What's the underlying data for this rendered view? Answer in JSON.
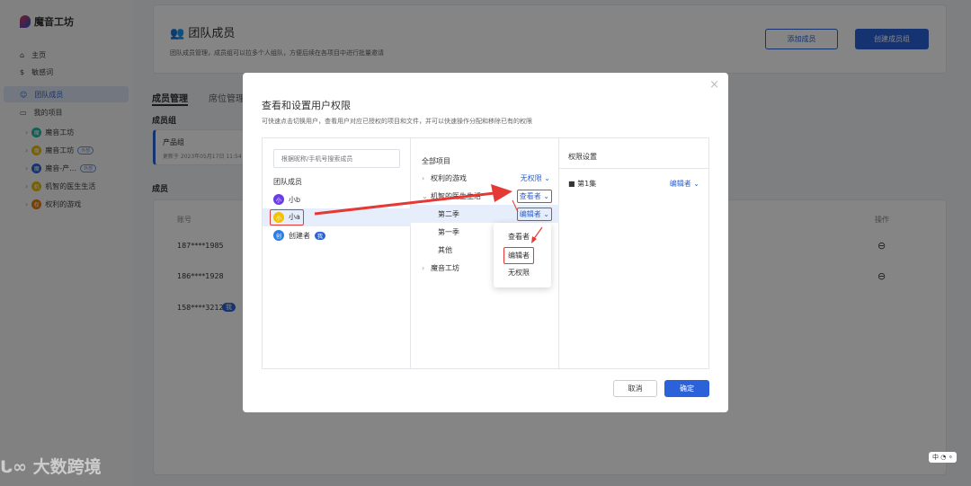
{
  "app": {
    "name": "魔音工坊"
  },
  "sidebar": {
    "items": [
      {
        "label": "主页",
        "icon": "home-icon"
      },
      {
        "label": "敏感词",
        "icon": "dollar-icon"
      },
      {
        "label": "团队成员",
        "icon": "team-icon"
      },
      {
        "label": "我的项目",
        "icon": "folder-icon"
      }
    ],
    "projects": [
      {
        "label": "魔音工坊",
        "initial": "魔",
        "color": "#1fb5a5",
        "tag": ""
      },
      {
        "label": "魔音工坊",
        "initial": "魔",
        "color": "#e6b800",
        "tag": "外部"
      },
      {
        "label": "魔音-产…",
        "initial": "魔",
        "color": "#2b62d9",
        "tag": "外部"
      },
      {
        "label": "机智的医生生活",
        "initial": "机",
        "color": "#e6b800",
        "tag": ""
      },
      {
        "label": "权利的游戏",
        "initial": "权",
        "color": "#e07a10",
        "tag": ""
      }
    ]
  },
  "header": {
    "title": "团队成员",
    "desc": "团队成员管理，成员组可以拉多个人组队，方便后续在各项目中进行批量邀请",
    "add_member": "添加成员",
    "create_group": "创建成员组"
  },
  "tabs": [
    "成员管理",
    "席位管理"
  ],
  "groups": {
    "title": "成员组",
    "item": {
      "name": "产品组",
      "updated": "更新于 2023年05月17日 11:54"
    }
  },
  "members": {
    "title": "成员",
    "col_account": "账号",
    "col_action": "操作",
    "rows": [
      {
        "account": "187****1985",
        "me": ""
      },
      {
        "account": "186****1928",
        "me": ""
      },
      {
        "account": "158****3212",
        "me": "我"
      }
    ]
  },
  "modal": {
    "title": "查看和设置用户权限",
    "desc": "可快速点击切换用户，查看用户对应已授权的项目和文件，并可以快速操作分配和移除已有的权限",
    "search_placeholder": "根据昵称/手机号搜索成员",
    "members_title": "团队成员",
    "users": [
      {
        "name": "小b",
        "initial": "小",
        "color": "#6a3de8"
      },
      {
        "name": "小a",
        "initial": "小",
        "color": "#f2c200"
      },
      {
        "name": "创建者",
        "initial": "创",
        "color": "#2b7de9",
        "badge": "我"
      }
    ],
    "projects_title": "全部项目",
    "tree": [
      {
        "label": "权利的游戏",
        "perm": "无权限"
      },
      {
        "label": "机智的医生生活",
        "perm": "查看者"
      },
      {
        "label": "第二季",
        "perm": "编辑者"
      },
      {
        "label": "第一季"
      },
      {
        "label": "其他"
      },
      {
        "label": "魔音工坊"
      }
    ],
    "dropdown": [
      "查看者",
      "编辑者",
      "无权限"
    ],
    "perm_title": "权限设置",
    "perm_item": {
      "label": "第1集",
      "perm": "编辑者"
    },
    "cancel": "取消",
    "ok": "确定"
  },
  "watermark": "大数跨境",
  "ime": "中"
}
